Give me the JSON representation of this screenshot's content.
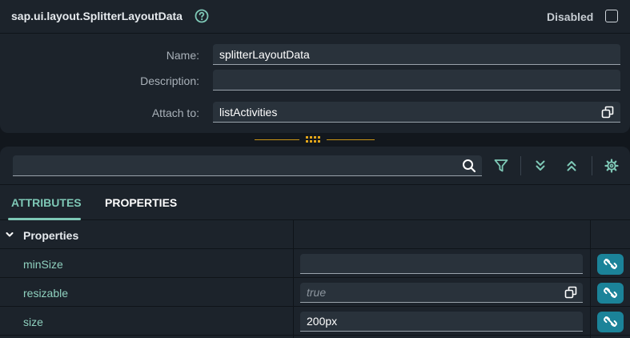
{
  "header": {
    "title": "sap.ui.layout.SplitterLayoutData",
    "help_icon": "help-circle-icon",
    "disabled_label": "Disabled",
    "disabled_checked": false
  },
  "form": {
    "name_label": "Name:",
    "name_value": "splitterLayoutData",
    "description_label": "Description:",
    "description_value": "",
    "attach_label": "Attach to:",
    "attach_value": "listActivities",
    "attach_icon": "open-in-new-window-icon"
  },
  "splitter": {
    "icon": "drag-handle-icon"
  },
  "toolbar": {
    "search_value": "",
    "search_icon": "search-icon",
    "filter_icon": "filter-icon",
    "expand_all_icon": "expand-all-icon",
    "collapse_all_icon": "collapse-all-icon",
    "settings_icon": "gear-icon"
  },
  "tabs": [
    {
      "label": "ATTRIBUTES",
      "selected": true
    },
    {
      "label": "PROPERTIES",
      "selected": false
    }
  ],
  "properties": {
    "group_label": "Properties",
    "group_expanded": true,
    "rows": [
      {
        "name": "minSize",
        "value": "",
        "placeholder": ""
      },
      {
        "name": "resizable",
        "value": "",
        "placeholder": "true"
      },
      {
        "name": "size",
        "value": "200px",
        "placeholder": ""
      }
    ],
    "bind_icon": "unlink-icon"
  },
  "colors": {
    "accent": "#7ec8b6",
    "bind_button": "#1b8399",
    "splitter": "#c79316",
    "panel": "#1c232b",
    "background": "#12171d"
  }
}
